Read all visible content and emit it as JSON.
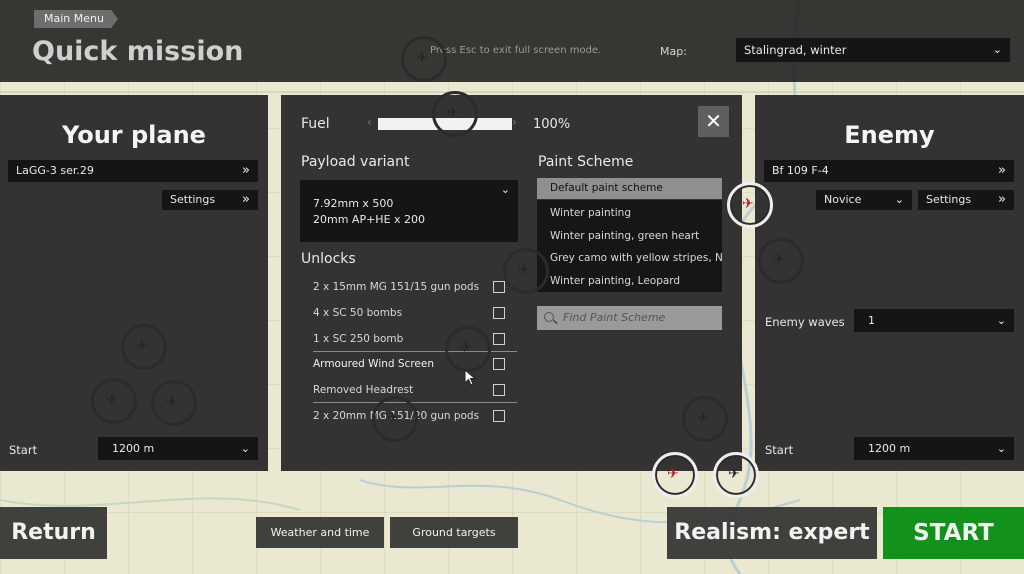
{
  "header": {
    "main_menu": "Main Menu",
    "title": "Quick mission",
    "esc_hint": "Press Esc to exit full screen mode.",
    "map_label": "Map:",
    "map_value": "Stalingrad, winter"
  },
  "your_plane": {
    "title": "Your plane",
    "plane": "LaGG-3 ser.29",
    "settings": "Settings",
    "start_label": "Start",
    "start_value": "1200 m"
  },
  "loadout": {
    "fuel_label": "Fuel",
    "fuel_value": "100%",
    "fuel_fraction": 1.0,
    "payload_label": "Payload variant",
    "payload_lines": [
      "7.92mm x 500",
      "20mm AP+HE x 200"
    ],
    "unlocks_label": "Unlocks",
    "unlocks": [
      {
        "label": "2 x 15mm MG 151/15 gun pods",
        "checked": false
      },
      {
        "label": "4 x SC 50 bombs",
        "checked": false
      },
      {
        "label": "1 x SC 250 bomb",
        "checked": false
      },
      {
        "label": "Armoured Wind Screen",
        "checked": false
      },
      {
        "label": "Removed Headrest",
        "checked": false
      },
      {
        "label": "2 x 20mm MG 151/20 gun pods",
        "checked": false
      }
    ],
    "paint_label": "Paint Scheme",
    "paint_selected": "Default paint scheme",
    "paint_options": [
      "Winter painting",
      "Winter painting, green heart",
      "Grey camo with yellow stripes, No",
      "Winter painting, Leopard"
    ],
    "paint_search_placeholder": "Find Paint Scheme",
    "close": "✕"
  },
  "enemy": {
    "title": "Enemy",
    "plane": "Bf 109 F-4",
    "skill": "Novice",
    "settings": "Settings",
    "waves_label": "Enemy waves",
    "waves_value": "1",
    "start_label": "Start",
    "start_value": "1200 m"
  },
  "footer": {
    "return": "Return",
    "weather": "Weather and time",
    "ground": "Ground targets",
    "realism": "Realism: expert",
    "start": "START"
  },
  "icons": {
    "chevron": "chevron-down-icon",
    "double_chevron": "double-chevron-right-icon",
    "search": "search-icon",
    "close": "close-icon",
    "plane": "plane-icon"
  },
  "colors": {
    "start_button": "#12921a",
    "panel": "#2c2c2a",
    "field": "#151515",
    "paint_selected": "#8f8f8f"
  }
}
